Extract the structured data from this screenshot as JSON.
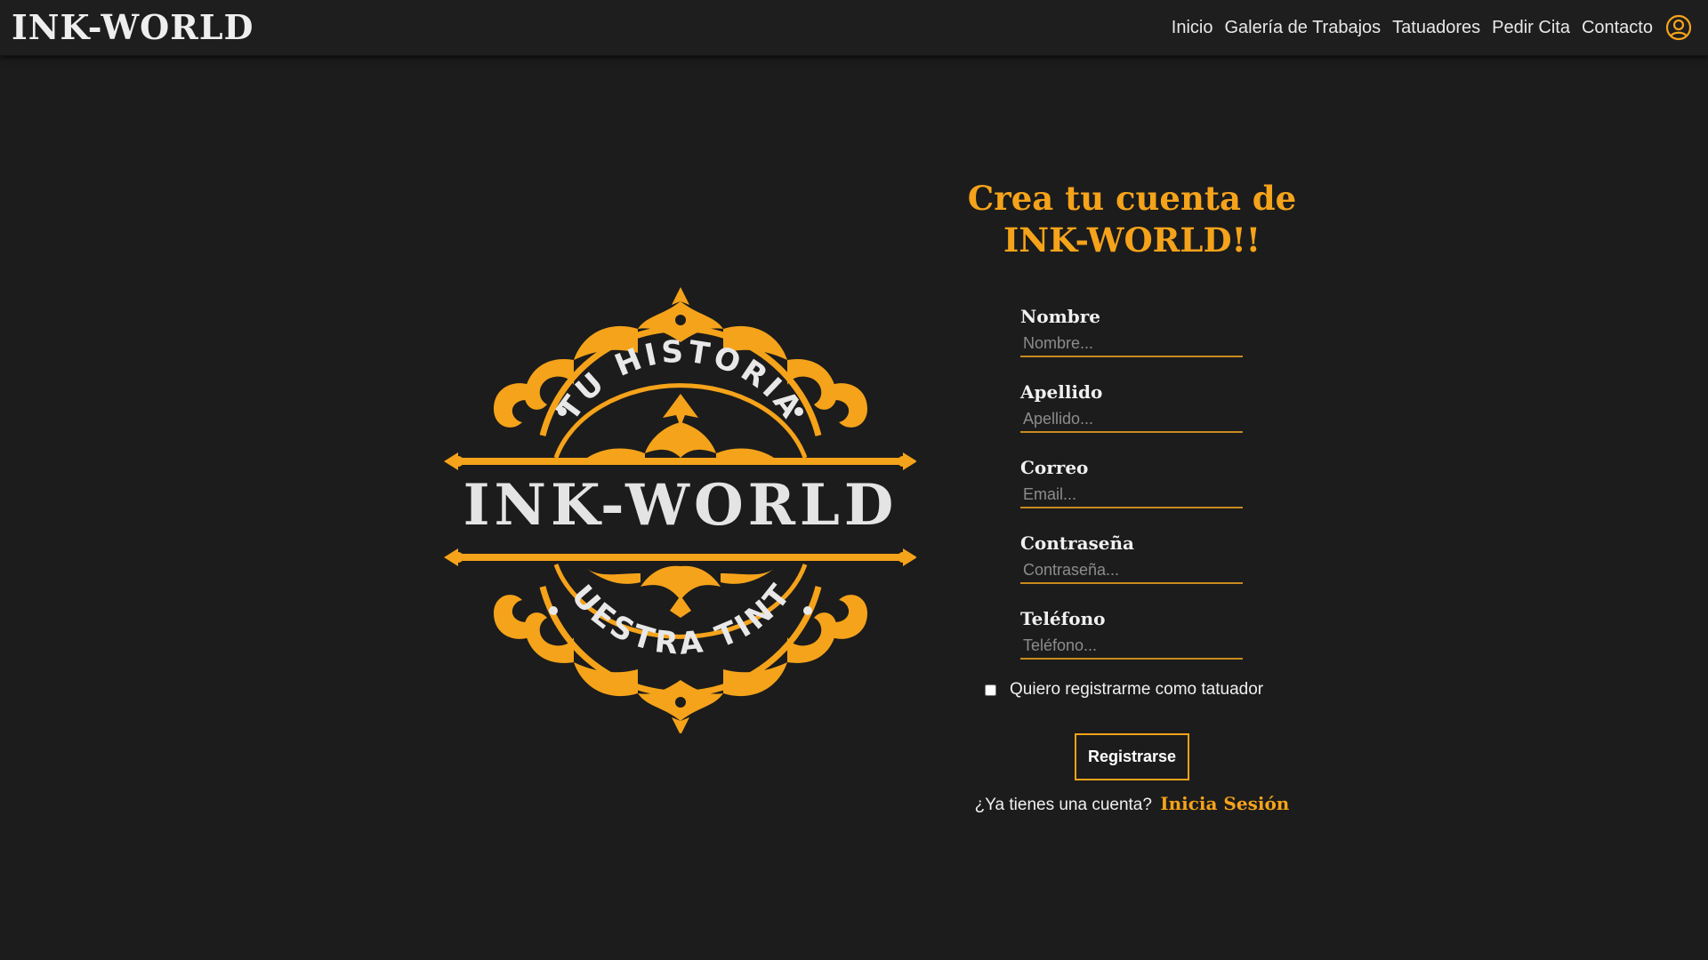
{
  "header": {
    "brand": "INK-WORLD",
    "nav": [
      {
        "label": "Inicio"
      },
      {
        "label": "Galería de Trabajos"
      },
      {
        "label": "Tatuadores"
      },
      {
        "label": "Pedir Cita"
      },
      {
        "label": "Contacto"
      }
    ],
    "user_icon": "user-circle-icon"
  },
  "logo": {
    "top_text": "TU HISTORIA",
    "main_text": "INK-WORLD",
    "bottom_text": "NUESTRA TINTA"
  },
  "form": {
    "title_line1": "Crea tu cuenta de",
    "title_line2": "INK-WORLD!!",
    "fields": [
      {
        "label": "Nombre",
        "placeholder": "Nombre...",
        "value": ""
      },
      {
        "label": "Apellido",
        "placeholder": "Apellido...",
        "value": ""
      },
      {
        "label": "Correo",
        "placeholder": "Email...",
        "value": ""
      },
      {
        "label": "Contraseña",
        "placeholder": "Contraseña...",
        "value": ""
      },
      {
        "label": "Teléfono",
        "placeholder": "Teléfono...",
        "value": ""
      }
    ],
    "checkbox_label": "Quiero registrarme como tatuador",
    "checkbox_checked": false,
    "submit_label": "Registrarse",
    "login_prompt": "¿Ya tienes una cuenta?",
    "login_link": "Inicia Sesión"
  },
  "colors": {
    "accent": "#f5a31a",
    "background": "#1c1c1c",
    "navbar": "#1e1e1e",
    "text": "#f0f0f0"
  }
}
